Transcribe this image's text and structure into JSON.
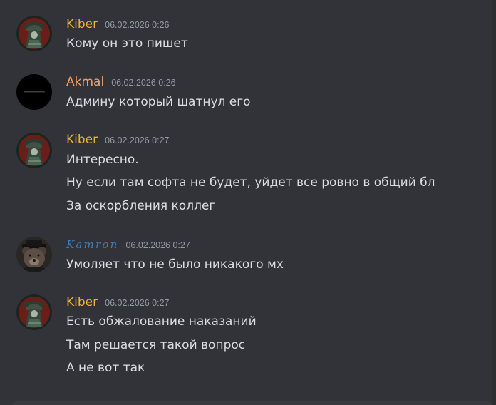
{
  "messages": [
    {
      "author": "Kiber",
      "timestamp": "06.02.2026 0:26",
      "avatar_icon": "hooded-figure-avatar-icon",
      "lines": [
        "Кому он это пишет"
      ]
    },
    {
      "author": "Akmal",
      "timestamp": "06.02.2026 0:26",
      "avatar_icon": "black-circle-avatar-icon",
      "lines": [
        "Админу который шатнул его"
      ]
    },
    {
      "author": "Kiber",
      "timestamp": "06.02.2026 0:27",
      "avatar_icon": "hooded-figure-avatar-icon",
      "lines": [
        "Интересно.",
        "Ну если там софта не будет, уйдет все ровно в общий бл",
        "За оскорбления коллег"
      ]
    },
    {
      "author": "Kamron",
      "timestamp": "06.02.2026 0:27",
      "avatar_icon": "bear-avatar-icon",
      "lines": [
        "Умоляет что не было никакого мх"
      ]
    },
    {
      "author": "Kiber",
      "timestamp": "06.02.2026 0:27",
      "avatar_icon": "hooded-figure-avatar-icon",
      "lines": [
        "Есть обжалование наказаний",
        "Там решается такой вопрос",
        "А не вот так"
      ]
    }
  ],
  "colors": {
    "background": "#313338",
    "kiber_name": "#f0b232",
    "akmal_name": "#f5a26a",
    "kamron_name": "#3f7fb8",
    "timestamp": "#949ba4",
    "message_text": "#dbdee1"
  }
}
